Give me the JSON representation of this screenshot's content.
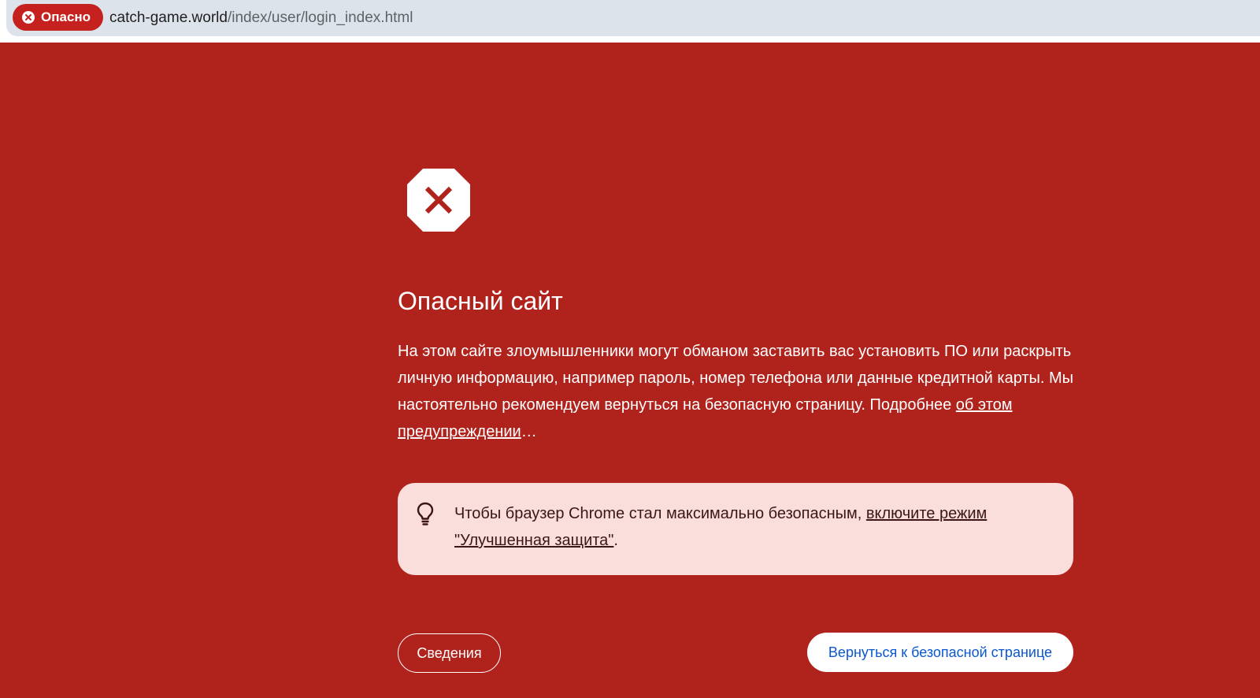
{
  "address_bar": {
    "security_chip": "Опасно",
    "url_host": "catch-game.world",
    "url_path": "/index/user/login_index.html"
  },
  "interstitial": {
    "icon": "stop-sign-x-icon",
    "title": "Опасный сайт",
    "body": "На этом сайте злоумышленники могут обманом заставить вас установить ПО или раскрыть личную информацию, например пароль, номер телефона или данные кредитной карты. Мы настоятельно рекомендуем вернуться на безопасную страницу. Подробнее ",
    "learn_more_link": "об этом предупреждении",
    "body_suffix": "…",
    "tip": {
      "icon": "lightbulb-icon",
      "text": "Чтобы браузер Chrome стал максимально безопасным, ",
      "link": "включите режим \"Улучшенная защита\"",
      "suffix": "."
    },
    "details_button": "Сведения",
    "back_button": "Вернуться к безопасной странице"
  },
  "colors": {
    "background": "#b0231d",
    "chip": "#c5221f",
    "tip_background": "#fadedc",
    "link_blue": "#0b57d0"
  }
}
